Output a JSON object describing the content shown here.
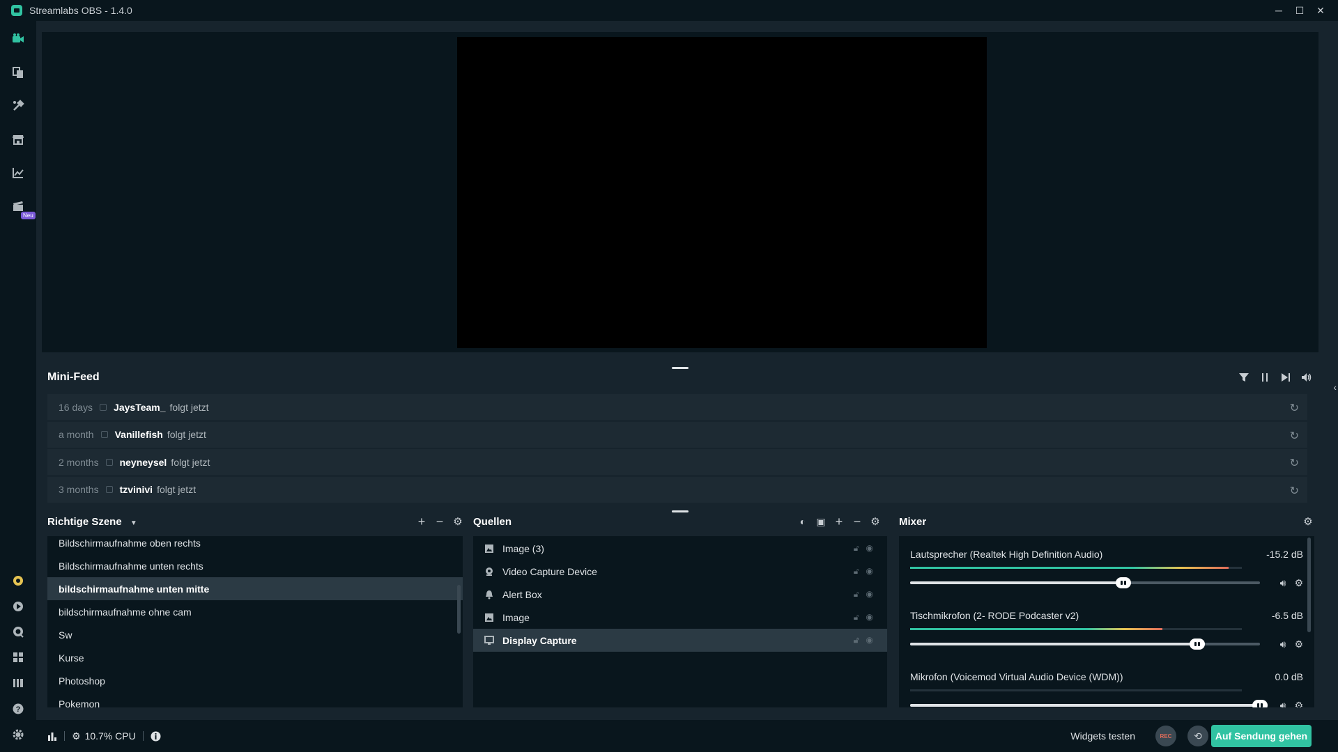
{
  "window": {
    "title": "Streamlabs OBS - 1.4.0",
    "minimize": "─",
    "maximize": "☐",
    "close": "✕"
  },
  "nav": {
    "new_badge": "Neu"
  },
  "minifeed": {
    "title": "Mini-Feed",
    "items": [
      {
        "time": "16 days",
        "user": "JaysTeam_",
        "action": "folgt jetzt"
      },
      {
        "time": "a month",
        "user": "Vanillefish",
        "action": "folgt jetzt"
      },
      {
        "time": "2 months",
        "user": "neyneysel",
        "action": "folgt jetzt"
      },
      {
        "time": "3 months",
        "user": "tzvinivi",
        "action": "folgt jetzt"
      }
    ]
  },
  "scenes": {
    "title": "Richtige Szene",
    "items": [
      {
        "label": "Bildschirmaufnahme oben rechts"
      },
      {
        "label": "Bildschirmaufnahme unten rechts"
      },
      {
        "label": "bildschirmaufnahme unten mitte"
      },
      {
        "label": "bildschirmaufnahme ohne cam"
      },
      {
        "label": "Sw"
      },
      {
        "label": "Kurse"
      },
      {
        "label": "Photoshop"
      },
      {
        "label": "Pokemon"
      }
    ],
    "active_index": 2
  },
  "sources": {
    "title": "Quellen",
    "items": [
      {
        "label": "Image (3)",
        "icon": "image-icon"
      },
      {
        "label": "Video Capture Device",
        "icon": "webcam-icon"
      },
      {
        "label": "Alert Box",
        "icon": "bell-icon"
      },
      {
        "label": "Image",
        "icon": "image-icon"
      },
      {
        "label": "Display Capture",
        "icon": "monitor-icon"
      }
    ],
    "active_index": 4
  },
  "mixer": {
    "title": "Mixer",
    "items": [
      {
        "name": "Lautsprecher (Realtek High Definition Audio)",
        "db": "-15.2 dB",
        "level": 0.61,
        "meter": 0.96
      },
      {
        "name": "Tischmikrofon (2- RODE Podcaster v2)",
        "db": "-6.5 dB",
        "level": 0.82,
        "meter": 0.76
      },
      {
        "name": "Mikrofon (Voicemod Virtual Audio Device (WDM))",
        "db": "0.0 dB",
        "level": 1.0,
        "meter": 0.0
      }
    ]
  },
  "footer": {
    "cpu": "10.7% CPU",
    "widgets_test": "Widgets testen",
    "rec": "REC",
    "go_live": "Auf Sendung gehen"
  },
  "colors": {
    "accent": "#31c3a2",
    "background": "#17242d",
    "panel": "#09161d"
  }
}
